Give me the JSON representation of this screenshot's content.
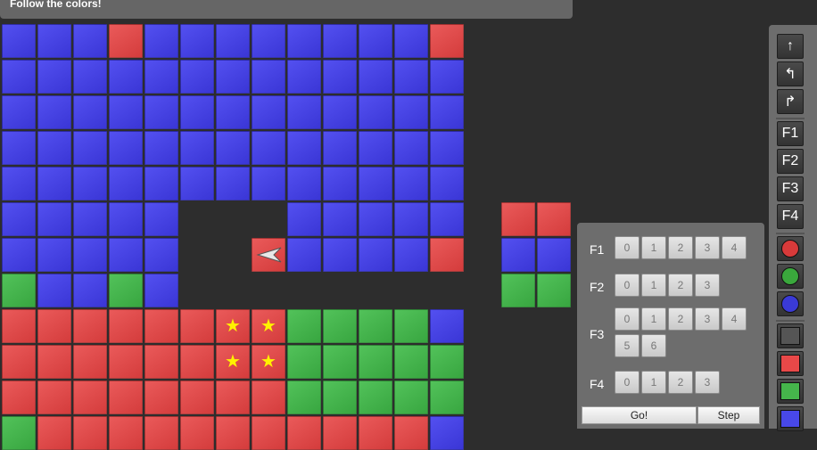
{
  "header": {
    "message": "Follow the colors!"
  },
  "board": {
    "rows": [
      "bbbrbbbbbbbbr",
      "bbbbbbbbbbbbb",
      "bbbbbbbbbbbbb",
      "bbbbbbbbbbbbb",
      "bbbbbbbbbbbbb",
      "bbbbb...bbbbb",
      "bbbbb..rbbbbr",
      "gbbgb........",
      "rrrrrrrrggggb",
      "rrrrrrrrggggg",
      "rrrrrrrrggggg",
      "grrrrrrrrrrrb"
    ],
    "side_rows": [
      "rr",
      "bb",
      "gg"
    ],
    "stars": [
      [
        8,
        6
      ],
      [
        8,
        7
      ],
      [
        9,
        6
      ],
      [
        9,
        7
      ]
    ],
    "ship": {
      "row": 6,
      "col": 7,
      "direction": "left"
    },
    "star_glyph": "★"
  },
  "toolbar": {
    "moves": [
      {
        "name": "forward-arrow-icon",
        "glyph": "↑"
      },
      {
        "name": "turn-left-icon",
        "glyph": "↰"
      },
      {
        "name": "turn-right-icon",
        "glyph": "↱"
      }
    ],
    "functions": [
      "F1",
      "F2",
      "F3",
      "F4"
    ],
    "conditions": [
      "#d83a3a",
      "#3aa83c",
      "#3a3ad6"
    ],
    "paints": [
      "#555555",
      "#e84848",
      "#45b54b",
      "#4848e8"
    ]
  },
  "program": {
    "functions": [
      {
        "label": "F1",
        "slots": [
          "0",
          "1",
          "2",
          "3",
          "4"
        ]
      },
      {
        "label": "F2",
        "slots": [
          "0",
          "1",
          "2",
          "3"
        ]
      },
      {
        "label": "F3",
        "slots": [
          "0",
          "1",
          "2",
          "3",
          "4",
          "5",
          "6"
        ]
      },
      {
        "label": "F4",
        "slots": [
          "0",
          "1",
          "2",
          "3"
        ]
      }
    ],
    "go_label": "Go!",
    "step_label": "Step"
  },
  "colors": {
    "blue": "#4340e6",
    "red": "#de4848",
    "green": "#45b54b",
    "star": "#fff200"
  }
}
